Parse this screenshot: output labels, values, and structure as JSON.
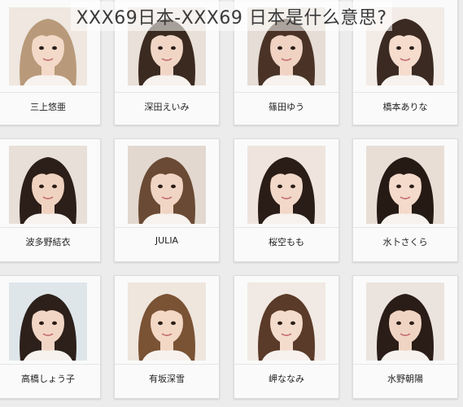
{
  "title": "XXX69日本-XXX69 日本是什么意思?",
  "people": [
    {
      "name": "三上悠亜",
      "hair": "#b89a7a",
      "bg": "#efe7e0",
      "skin": "#f3d9c8"
    },
    {
      "name": "深田えいみ",
      "hair": "#3b2a20",
      "bg": "#e9e0d9",
      "skin": "#f1d6c6"
    },
    {
      "name": "篠田ゆう",
      "hair": "#4a3326",
      "bg": "#e5ddd6",
      "skin": "#f0d3c2"
    },
    {
      "name": "橋本ありな",
      "hair": "#3a2a22",
      "bg": "#f2ebe6",
      "skin": "#f5dccd"
    },
    {
      "name": "波多野結衣",
      "hair": "#2c1e18",
      "bg": "#e8dfd8",
      "skin": "#efd2c0"
    },
    {
      "name": "JULIA",
      "hair": "#6a4a34",
      "bg": "#e3d8cf",
      "skin": "#f1d5c4"
    },
    {
      "name": "桜空もも",
      "hair": "#2a1d17",
      "bg": "#efe5de",
      "skin": "#f2d8c8"
    },
    {
      "name": "水卜さくら",
      "hair": "#261a15",
      "bg": "#e9ded6",
      "skin": "#f4dacb"
    },
    {
      "name": "高橋しょう子",
      "hair": "#2d201a",
      "bg": "#dfe6ea",
      "skin": "#f2d6c5"
    },
    {
      "name": "有坂深雪",
      "hair": "#7a5234",
      "bg": "#efe6dd",
      "skin": "#f3d8c6"
    },
    {
      "name": "岬ななみ",
      "hair": "#5a3a28",
      "bg": "#f1e9e3",
      "skin": "#f4dccd"
    },
    {
      "name": "水野朝陽",
      "hair": "#2a1c16",
      "bg": "#ebe4de",
      "skin": "#f0d4c3"
    }
  ]
}
